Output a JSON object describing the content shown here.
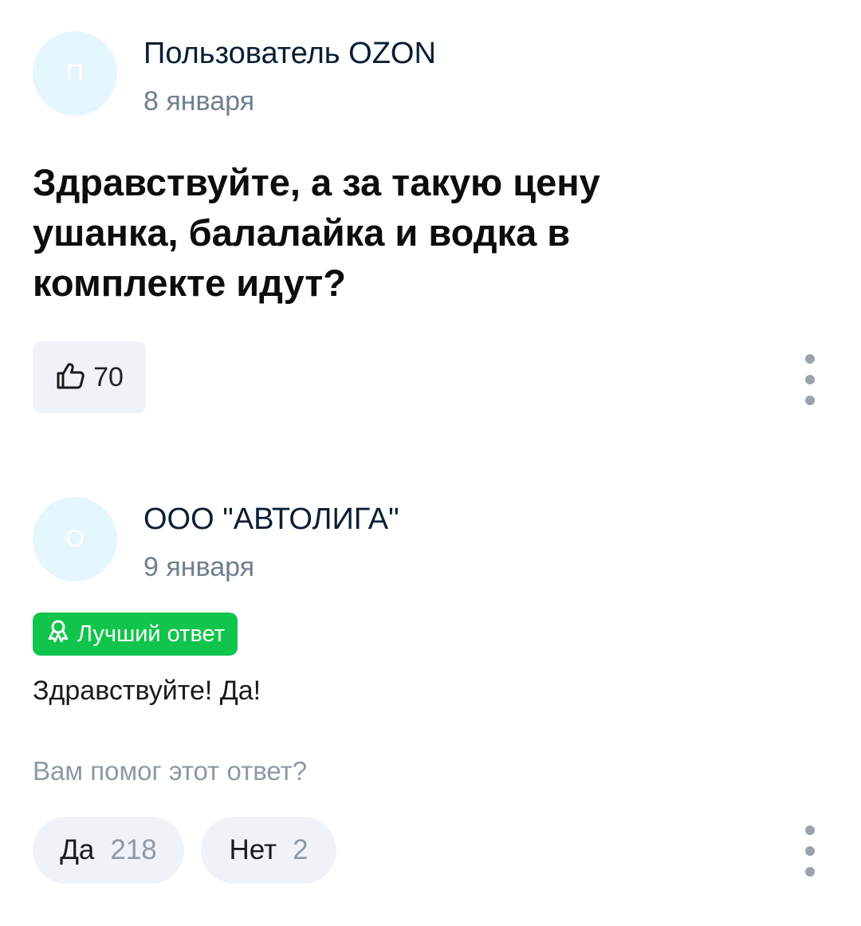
{
  "question": {
    "avatar_letter": "П",
    "author": "Пользователь OZON",
    "date": "8 января",
    "text": "Здравствуйте, а за такую цену ушанка, балалайка и водка в комплекте идут?",
    "likes": "70"
  },
  "answer": {
    "avatar_letter": "О",
    "author": "ООО \"АВТОЛИГА\"",
    "date": "9 января",
    "badge": "Лучший ответ",
    "text": "Здравствуйте! Да!",
    "helpful_prompt": "Вам помог этот ответ?",
    "yes_label": "Да",
    "yes_count": "218",
    "no_label": "Нет",
    "no_count": "2"
  },
  "colors": {
    "badge_green": "#10c44c",
    "avatar_bg": "#e6f6ff",
    "button_bg": "#eff3f8",
    "muted_text": "#8d99a5"
  },
  "icons": {
    "like": "thumbs-up-icon",
    "more": "more-vertical-icon",
    "badge": "award-icon"
  }
}
